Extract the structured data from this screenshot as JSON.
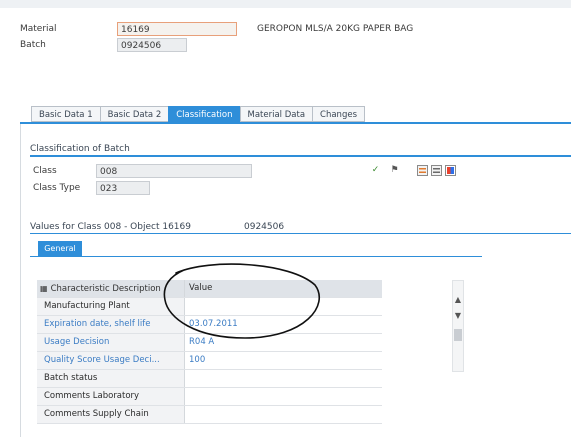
{
  "header": {
    "material_label": "Material",
    "material_value": "16169",
    "material_desc": "GEROPON MLS/A 20KG PAPER BAG",
    "batch_label": "Batch",
    "batch_value": "0924506"
  },
  "tabs": [
    "Basic Data 1",
    "Basic Data 2",
    "Classification",
    "Material Data",
    "Changes"
  ],
  "active_tab": "Classification",
  "classification": {
    "title": "Classification of Batch",
    "class_label": "Class",
    "class_value": "008",
    "class_type_label": "Class Type",
    "class_type_value": "023",
    "toolbar_icons": [
      "check-icon",
      "flag-icon",
      "select-all-icon",
      "deselect-icon",
      "color-icon"
    ]
  },
  "values": {
    "title": "Values for Class 008 - Object 16169",
    "object_batch": "0924506",
    "subtab": "General"
  },
  "grid": {
    "col_char": "Characteristic Description",
    "col_value": "Value",
    "rows": [
      {
        "name": "Manufacturing Plant",
        "value": "",
        "blue": false
      },
      {
        "name": "Expiration date, shelf life",
        "value": "03.07.2011",
        "blue": true
      },
      {
        "name": "Usage Decision",
        "value": "R04    A",
        "blue": true
      },
      {
        "name": "Quality Score Usage Deci...",
        "value": "100",
        "blue": true
      },
      {
        "name": "Batch status",
        "value": "",
        "blue": false
      },
      {
        "name": "Comments Laboratory",
        "value": "",
        "blue": false
      },
      {
        "name": "Comments Supply Chain",
        "value": "",
        "blue": false
      }
    ]
  },
  "colors": {
    "accent": "#2e8ed9",
    "link": "#3b7cc4",
    "annotation": "#111111"
  }
}
